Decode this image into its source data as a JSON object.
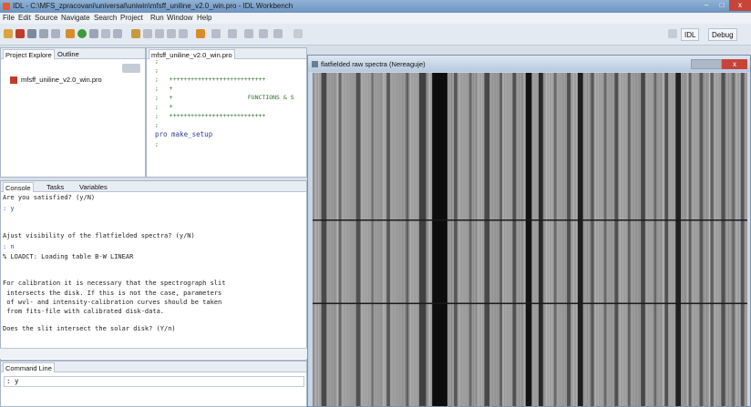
{
  "window": {
    "title": "IDL - C:\\MFS_zpracovani\\universal\\uniwin\\mfsff_uniline_v2.0_win.pro - IDL Workbench"
  },
  "controls": {
    "min": "–",
    "max": "□",
    "close": "x"
  },
  "menu": [
    "File",
    "Edit",
    "Source",
    "Navigate",
    "Search",
    "Project",
    "Run",
    "Window",
    "Help"
  ],
  "perspectives": {
    "idl": "IDL",
    "debug": "Debug"
  },
  "left_panel": {
    "tabs": [
      "Project Explore",
      "Outline"
    ],
    "items": [
      "mfsff_uniline_v2.0_win.pro"
    ]
  },
  "editor": {
    "tab": "mfsff_uniline_v2.0_win.pro",
    "lines": [
      ";",
      ";",
      ";   +++++++++++++++++++++++++++",
      ";   +",
      ";   +                     FUNCTIONS & S",
      ";   +",
      ";   +++++++++++++++++++++++++++",
      ";",
      "pro make_setup",
      ";"
    ]
  },
  "console": {
    "tabs": [
      "Console",
      "Tasks",
      "Variables"
    ],
    "lines": [
      {
        "text": "Are you satisfied? (y/N)",
        "kind": "out"
      },
      {
        "text": ": y",
        "kind": "in"
      },
      {
        "text": "",
        "kind": "out"
      },
      {
        "text": "",
        "kind": "out"
      },
      {
        "text": "Ajust visibility of the flatfielded spectra? (y/N)",
        "kind": "out"
      },
      {
        "text": ": n",
        "kind": "in"
      },
      {
        "text": "% LOADCT: Loading table B-W LINEAR",
        "kind": "out"
      },
      {
        "text": "",
        "kind": "out"
      },
      {
        "text": "",
        "kind": "out"
      },
      {
        "text": "For calibration it is necessary that the spectrograph slit",
        "kind": "out"
      },
      {
        "text": " intersects the disk. If this is not the case, parameters",
        "kind": "out"
      },
      {
        "text": " of wvl- and intensity-calibration curves should be taken",
        "kind": "out"
      },
      {
        "text": " from fits-file with calibrated disk-data.",
        "kind": "out"
      },
      {
        "text": "",
        "kind": "out"
      },
      {
        "text": "Does the slit intersect the solar disk? (Y/n)",
        "kind": "out"
      }
    ]
  },
  "command_line": {
    "tab": "Command Line",
    "value": ": y"
  },
  "spectra_window": {
    "title": "flatfielded raw spectra (Nereaguje)"
  },
  "spectra_lines": [
    {
      "x": 0.02,
      "w": 0.012,
      "d": 0.55
    },
    {
      "x": 0.06,
      "w": 0.006,
      "d": 0.35
    },
    {
      "x": 0.1,
      "w": 0.01,
      "d": 0.5
    },
    {
      "x": 0.135,
      "w": 0.005,
      "d": 0.3
    },
    {
      "x": 0.17,
      "w": 0.008,
      "d": 0.45
    },
    {
      "x": 0.215,
      "w": 0.006,
      "d": 0.4
    },
    {
      "x": 0.245,
      "w": 0.016,
      "d": 0.6
    },
    {
      "x": 0.275,
      "w": 0.035,
      "d": 0.92
    },
    {
      "x": 0.325,
      "w": 0.008,
      "d": 0.45
    },
    {
      "x": 0.36,
      "w": 0.006,
      "d": 0.35
    },
    {
      "x": 0.395,
      "w": 0.012,
      "d": 0.55
    },
    {
      "x": 0.43,
      "w": 0.006,
      "d": 0.4
    },
    {
      "x": 0.46,
      "w": 0.008,
      "d": 0.5
    },
    {
      "x": 0.49,
      "w": 0.014,
      "d": 0.88
    },
    {
      "x": 0.52,
      "w": 0.01,
      "d": 0.75
    },
    {
      "x": 0.555,
      "w": 0.006,
      "d": 0.35
    },
    {
      "x": 0.585,
      "w": 0.009,
      "d": 0.5
    },
    {
      "x": 0.61,
      "w": 0.012,
      "d": 0.82
    },
    {
      "x": 0.64,
      "w": 0.007,
      "d": 0.45
    },
    {
      "x": 0.67,
      "w": 0.006,
      "d": 0.35
    },
    {
      "x": 0.695,
      "w": 0.008,
      "d": 0.5
    },
    {
      "x": 0.725,
      "w": 0.006,
      "d": 0.4
    },
    {
      "x": 0.755,
      "w": 0.01,
      "d": 0.55
    },
    {
      "x": 0.785,
      "w": 0.006,
      "d": 0.35
    },
    {
      "x": 0.81,
      "w": 0.008,
      "d": 0.5
    },
    {
      "x": 0.835,
      "w": 0.012,
      "d": 0.8
    },
    {
      "x": 0.865,
      "w": 0.006,
      "d": 0.4
    },
    {
      "x": 0.89,
      "w": 0.008,
      "d": 0.45
    },
    {
      "x": 0.915,
      "w": 0.007,
      "d": 0.4
    },
    {
      "x": 0.94,
      "w": 0.009,
      "d": 0.5
    },
    {
      "x": 0.965,
      "w": 0.006,
      "d": 0.35
    },
    {
      "x": 0.985,
      "w": 0.008,
      "d": 0.45
    }
  ],
  "spectra_rows": [
    0.44,
    0.69
  ]
}
